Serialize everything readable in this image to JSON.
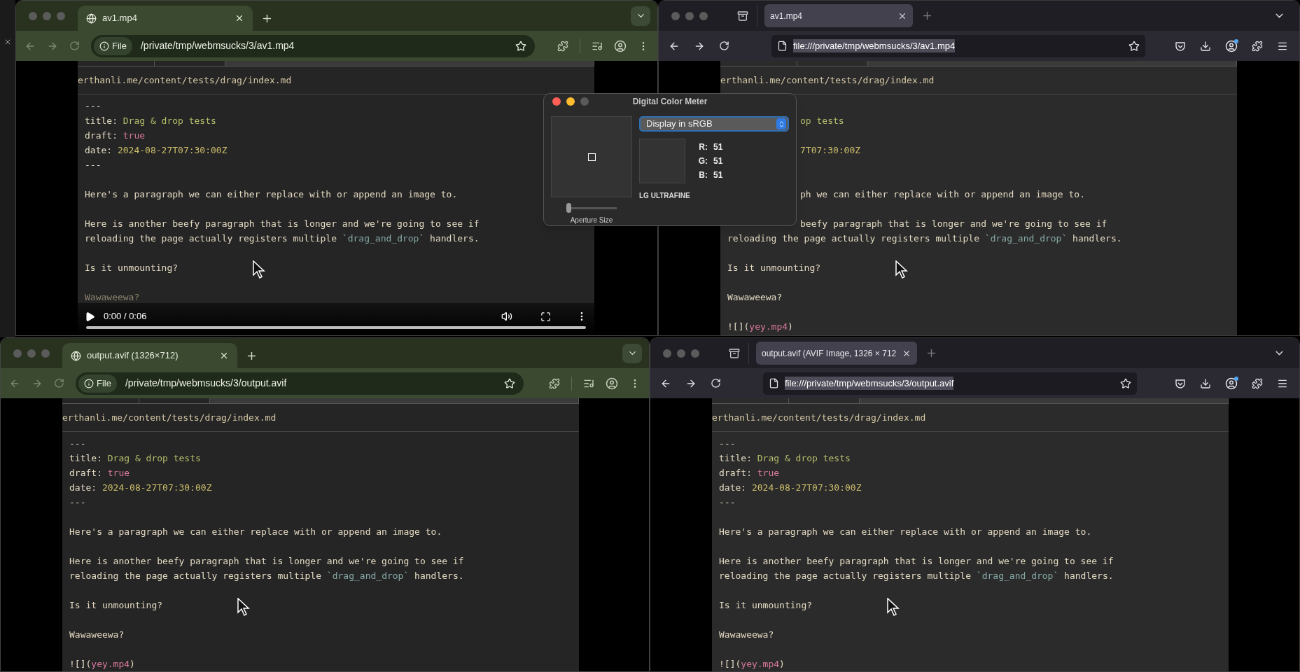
{
  "windows": [
    {
      "kind": "chrome",
      "tab": {
        "title": "av1.mp4"
      },
      "chip": "File",
      "url": "/private/tmp/webmsucks/3/av1.mp4",
      "url_selected": false,
      "content": {
        "path": "erthanli.me/content/tests/drag/index.md",
        "lines": [
          {
            "kind": "text",
            "parts": [
              {
                "text": "---"
              }
            ]
          },
          {
            "kind": "text",
            "parts": [
              {
                "text": "title: "
              },
              {
                "text": "Drag & drop tests",
                "color": "#b6bd6c"
              }
            ]
          },
          {
            "kind": "text",
            "parts": [
              {
                "text": "draft: "
              },
              {
                "text": "true",
                "color": "#d8789d"
              }
            ]
          },
          {
            "kind": "text",
            "parts": [
              {
                "text": "date: "
              },
              {
                "text": "2024-08-27T07:30:00Z",
                "color": "#cdbf6c"
              }
            ]
          },
          {
            "kind": "text",
            "parts": [
              {
                "text": "---"
              }
            ]
          },
          {
            "kind": "blank"
          },
          {
            "kind": "text",
            "parts": [
              {
                "text": "Here's a paragraph we can either replace with or append an image to."
              }
            ]
          },
          {
            "kind": "blank"
          },
          {
            "kind": "text",
            "parts": [
              {
                "text": "Here is another beefy paragraph that is longer and we're going to see if"
              }
            ]
          },
          {
            "kind": "text",
            "parts": [
              {
                "text": "reloading the page actually registers multiple "
              },
              {
                "text": "`drag_and_drop`",
                "color": "#86a9a6"
              },
              {
                "text": " handlers."
              }
            ]
          },
          {
            "kind": "blank"
          },
          {
            "kind": "text",
            "parts": [
              {
                "text": "Is it unmounting?"
              }
            ]
          },
          {
            "kind": "blank"
          },
          {
            "kind": "text",
            "parts": [
              {
                "text": "Wawaweewa?",
                "color": "#8a806c"
              }
            ]
          }
        ]
      },
      "video": {
        "time": "0:00 / 0:06",
        "level": 0
      }
    },
    {
      "kind": "firefox",
      "tab": {
        "title": "av1.mp4"
      },
      "url": "file:///private/tmp/webmsucks/3/av1.mp4",
      "url_selected": true,
      "content": {
        "path": "erthanli.me/content/tests/drag/index.md",
        "lines": [
          {
            "kind": "blank"
          },
          {
            "kind": "text",
            "partial": true,
            "parts": [
              {
                "text": "op tests",
                "color": "#b6bd6c"
              }
            ]
          },
          {
            "kind": "blank"
          },
          {
            "kind": "text",
            "partial": true,
            "parts": [
              {
                "text": "7T07:30:00Z",
                "color": "#cdbf6c"
              }
            ]
          },
          {
            "kind": "blank"
          },
          {
            "kind": "blank"
          },
          {
            "kind": "text",
            "partial": true,
            "parts": [
              {
                "text": "ph we can either replace with or append an image to."
              }
            ]
          },
          {
            "kind": "blank"
          },
          {
            "kind": "text",
            "partial": true,
            "parts": [
              {
                "text": "beefy paragraph that is longer and we're going to see if"
              }
            ]
          },
          {
            "kind": "text",
            "parts": [
              {
                "text": "reloading the page actually registers multiple "
              },
              {
                "text": "`drag_and_drop`",
                "color": "#86a9a6"
              },
              {
                "text": " handlers."
              }
            ]
          },
          {
            "kind": "blank"
          },
          {
            "kind": "text",
            "parts": [
              {
                "text": "Is it unmounting?"
              }
            ]
          },
          {
            "kind": "blank"
          },
          {
            "kind": "text",
            "parts": [
              {
                "text": "Wawaweewa?"
              }
            ]
          },
          {
            "kind": "blank"
          },
          {
            "kind": "text",
            "parts": [
              {
                "text": "![]("
              },
              {
                "text": "yey.mp4",
                "color": "#d8789d"
              },
              {
                "text": ")"
              }
            ]
          }
        ]
      }
    },
    {
      "kind": "chrome",
      "tab": {
        "title": "output.avif (1326×712)"
      },
      "chip": "File",
      "url": "/private/tmp/webmsucks/3/output.avif",
      "url_selected": false,
      "content": {
        "path": "erthanli.me/content/tests/drag/index.md",
        "lines": [
          {
            "kind": "text",
            "parts": [
              {
                "text": "---"
              }
            ]
          },
          {
            "kind": "text",
            "parts": [
              {
                "text": "title: "
              },
              {
                "text": "Drag & drop tests",
                "color": "#b6bd6c"
              }
            ]
          },
          {
            "kind": "text",
            "parts": [
              {
                "text": "draft: "
              },
              {
                "text": "true",
                "color": "#d8789d"
              }
            ]
          },
          {
            "kind": "text",
            "parts": [
              {
                "text": "date: "
              },
              {
                "text": "2024-08-27T07:30:00Z",
                "color": "#cdbf6c"
              }
            ]
          },
          {
            "kind": "text",
            "parts": [
              {
                "text": "---"
              }
            ]
          },
          {
            "kind": "blank"
          },
          {
            "kind": "text",
            "parts": [
              {
                "text": "Here's a paragraph we can either replace with or append an image to."
              }
            ]
          },
          {
            "kind": "blank"
          },
          {
            "kind": "text",
            "parts": [
              {
                "text": "Here is another beefy paragraph that is longer and we're going to see if"
              }
            ]
          },
          {
            "kind": "text",
            "parts": [
              {
                "text": "reloading the page actually registers multiple "
              },
              {
                "text": "`drag_and_drop`",
                "color": "#86a9a6"
              },
              {
                "text": " handlers."
              }
            ]
          },
          {
            "kind": "blank"
          },
          {
            "kind": "text",
            "parts": [
              {
                "text": "Is it unmounting?"
              }
            ]
          },
          {
            "kind": "blank"
          },
          {
            "kind": "text",
            "parts": [
              {
                "text": "Wawaweewa?"
              }
            ]
          },
          {
            "kind": "blank"
          },
          {
            "kind": "text",
            "parts": [
              {
                "text": "![]("
              },
              {
                "text": "yey.mp4",
                "color": "#d8789d"
              },
              {
                "text": ")"
              }
            ]
          }
        ]
      }
    },
    {
      "kind": "firefox",
      "tab": {
        "title": "output.avif (AVIF Image, 1326 × 712"
      },
      "url": "file:///private/tmp/webmsucks/3/output.avif",
      "url_selected": true,
      "content": {
        "path": "erthanli.me/content/tests/drag/index.md",
        "lines": [
          {
            "kind": "text",
            "parts": [
              {
                "text": "---"
              }
            ]
          },
          {
            "kind": "text",
            "parts": [
              {
                "text": "title: "
              },
              {
                "text": "Drag & drop tests",
                "color": "#b6bd6c"
              }
            ]
          },
          {
            "kind": "text",
            "parts": [
              {
                "text": "draft: "
              },
              {
                "text": "true",
                "color": "#d8789d"
              }
            ]
          },
          {
            "kind": "text",
            "parts": [
              {
                "text": "date: "
              },
              {
                "text": "2024-08-27T07:30:00Z",
                "color": "#cdbf6c"
              }
            ]
          },
          {
            "kind": "text",
            "parts": [
              {
                "text": "---"
              }
            ]
          },
          {
            "kind": "blank"
          },
          {
            "kind": "text",
            "parts": [
              {
                "text": "Here's a paragraph we can either replace with or append an image to."
              }
            ]
          },
          {
            "kind": "blank"
          },
          {
            "kind": "text",
            "parts": [
              {
                "text": "Here is another beefy paragraph that is longer and we're going to see if"
              }
            ]
          },
          {
            "kind": "text",
            "parts": [
              {
                "text": "reloading the page actually registers multiple "
              },
              {
                "text": "`drag_and_drop`",
                "color": "#86a9a6"
              },
              {
                "text": " handlers."
              }
            ]
          },
          {
            "kind": "blank"
          },
          {
            "kind": "text",
            "parts": [
              {
                "text": "Is it unmounting?"
              }
            ]
          },
          {
            "kind": "blank"
          },
          {
            "kind": "text",
            "parts": [
              {
                "text": "Wawaweewa?"
              }
            ]
          },
          {
            "kind": "blank"
          },
          {
            "kind": "text",
            "parts": [
              {
                "text": "![]("
              },
              {
                "text": "yey.mp4",
                "color": "#d8789d"
              },
              {
                "text": ")"
              }
            ]
          }
        ]
      }
    }
  ],
  "color_meter": {
    "title": "Digital Color Meter",
    "mode": "Display in sRGB",
    "channels": [
      {
        "label": "R:",
        "value": "51"
      },
      {
        "label": "G:",
        "value": "51"
      },
      {
        "label": "B:",
        "value": "51"
      }
    ],
    "display": "LG ULTRAFINE",
    "aperture": {
      "label": "Aperture Size",
      "level": 0
    }
  }
}
